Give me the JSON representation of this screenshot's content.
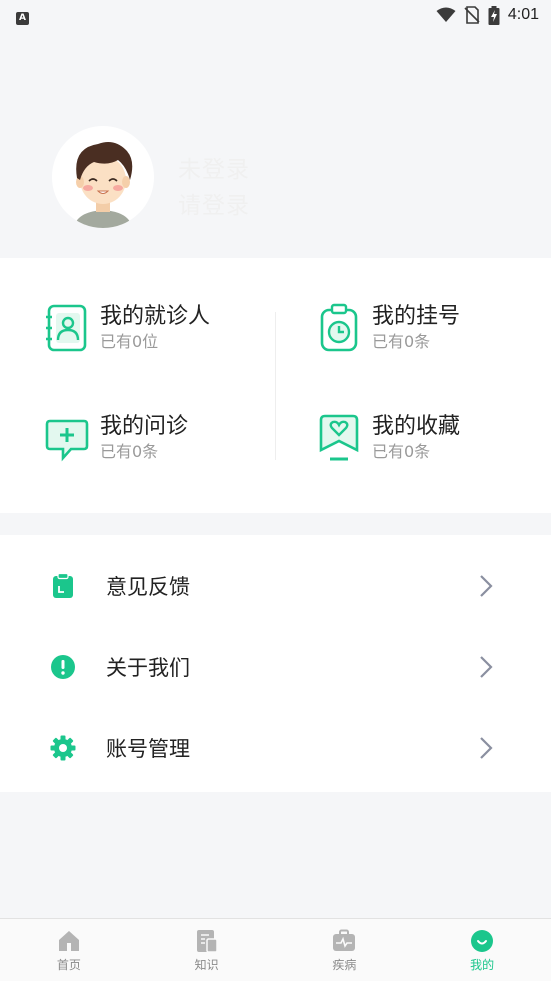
{
  "status_bar": {
    "app_badge": "A",
    "time": "4:01"
  },
  "profile": {
    "name": "未登录",
    "subtitle": "请登录"
  },
  "grid": [
    {
      "title": "我的就诊人",
      "sub": "已有0位",
      "icon": "patient-card-icon"
    },
    {
      "title": "我的挂号",
      "sub": "已有0条",
      "icon": "clipboard-clock-icon"
    },
    {
      "title": "我的问诊",
      "sub": "已有0条",
      "icon": "chat-plus-icon"
    },
    {
      "title": "我的收藏",
      "sub": "已有0条",
      "icon": "heart-bookmark-icon"
    }
  ],
  "menu": [
    {
      "label": "意见反馈",
      "icon": "feedback-icon"
    },
    {
      "label": "关于我们",
      "icon": "info-icon"
    },
    {
      "label": "账号管理",
      "icon": "gear-icon"
    }
  ],
  "tabs": [
    {
      "label": "首页",
      "icon": "home-icon",
      "active": false
    },
    {
      "label": "知识",
      "icon": "knowledge-icon",
      "active": false
    },
    {
      "label": "疾病",
      "icon": "disease-icon",
      "active": false
    },
    {
      "label": "我的",
      "icon": "smile-icon",
      "active": true
    }
  ],
  "colors": {
    "accent": "#1bc68c",
    "accent_light": "#e3f8ef",
    "background": "#f5f6f8",
    "tab_inactive": "#b4b4b4"
  }
}
